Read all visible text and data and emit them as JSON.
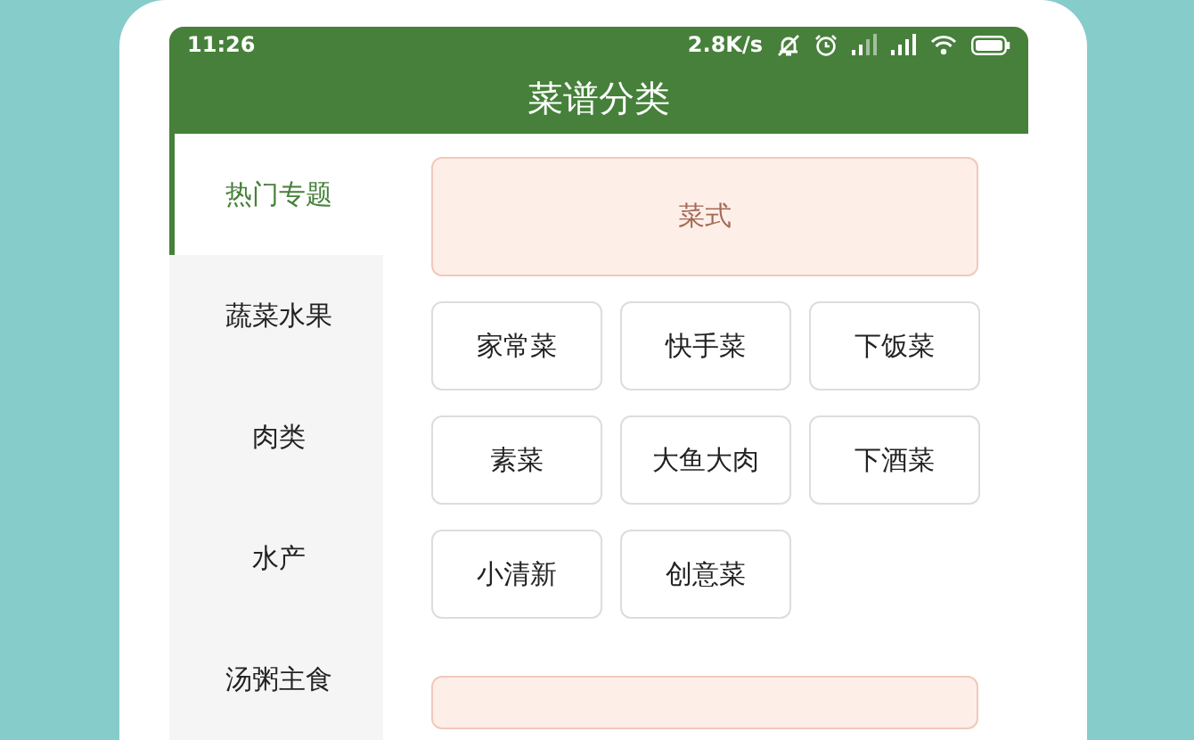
{
  "status_bar": {
    "time": "11:26",
    "speed": "2.8K/s"
  },
  "title": "菜谱分类",
  "sidebar": {
    "items": [
      {
        "label": "热门专题",
        "selected": true
      },
      {
        "label": "蔬菜水果",
        "selected": false
      },
      {
        "label": "肉类",
        "selected": false
      },
      {
        "label": "水产",
        "selected": false
      },
      {
        "label": "汤粥主食",
        "selected": false
      }
    ]
  },
  "section": {
    "title": "菜式",
    "tags": [
      "家常菜",
      "快手菜",
      "下饭菜",
      "素菜",
      "大鱼大肉",
      "下酒菜",
      "小清新",
      "创意菜"
    ]
  }
}
